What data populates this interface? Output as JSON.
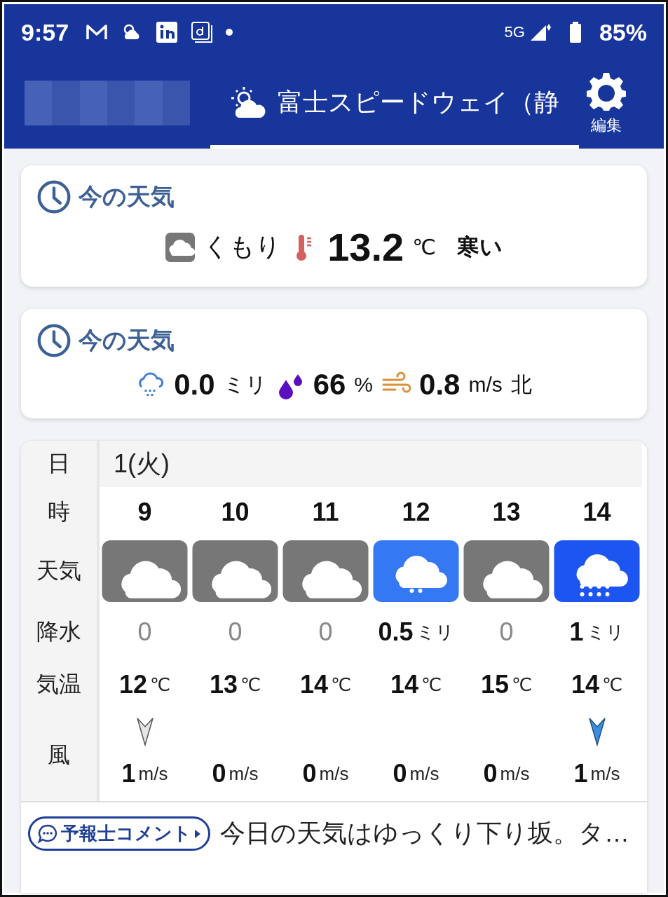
{
  "status_bar": {
    "time": "9:57",
    "network": "5G",
    "battery": "85%"
  },
  "tabs": [
    {
      "kind": "blurred",
      "selected": false
    },
    {
      "kind": "location",
      "label": "富士スピードウェイ（静",
      "selected": true
    }
  ],
  "settings": {
    "label": "編集"
  },
  "current": {
    "title": "今の天気",
    "condition": "くもり",
    "temperature": "13.2",
    "temp_unit": "℃",
    "feel": "寒い"
  },
  "current_detail": {
    "title": "今の天気",
    "precip": "0.0",
    "precip_unit": "ミリ",
    "humidity": "66",
    "humidity_unit": "%",
    "wind": "0.8",
    "wind_unit": "m/s",
    "wind_dir": "北"
  },
  "forecast": {
    "labels": {
      "day": "日",
      "hour": "時",
      "weather": "天気",
      "precip": "降水",
      "temp": "気温",
      "wind": "風"
    },
    "date": "1(火)",
    "hours": [
      {
        "hour": "9",
        "kind": "cloudy",
        "precip": "0",
        "dry": true,
        "temp": "12",
        "temp_unit": "℃",
        "arrow": {
          "kind": "pale"
        },
        "wind": "1",
        "wind_unit": "m/s"
      },
      {
        "hour": "10",
        "kind": "cloudy",
        "precip": "0",
        "dry": true,
        "temp": "13",
        "temp_unit": "℃",
        "wind": "0",
        "wind_unit": "m/s"
      },
      {
        "hour": "11",
        "kind": "cloudy",
        "precip": "0",
        "dry": true,
        "temp": "14",
        "temp_unit": "℃",
        "wind": "0",
        "wind_unit": "m/s"
      },
      {
        "hour": "12",
        "kind": "light-rain",
        "precip": "0.5",
        "precip_unit": "ミリ",
        "dry": false,
        "temp": "14",
        "temp_unit": "℃",
        "wind": "0",
        "wind_unit": "m/s"
      },
      {
        "hour": "13",
        "kind": "cloudy",
        "precip": "0",
        "dry": true,
        "temp": "15",
        "temp_unit": "℃",
        "wind": "0",
        "wind_unit": "m/s"
      },
      {
        "hour": "14",
        "kind": "rain",
        "precip": "1",
        "precip_unit": "ミリ",
        "dry": false,
        "temp": "14",
        "temp_unit": "℃",
        "arrow": {
          "kind": "blue"
        },
        "wind": "1",
        "wind_unit": "m/s"
      }
    ]
  },
  "comment": {
    "button": "予報士コメント",
    "text": "今日の天気はゆっくり下り坂。タ…"
  }
}
